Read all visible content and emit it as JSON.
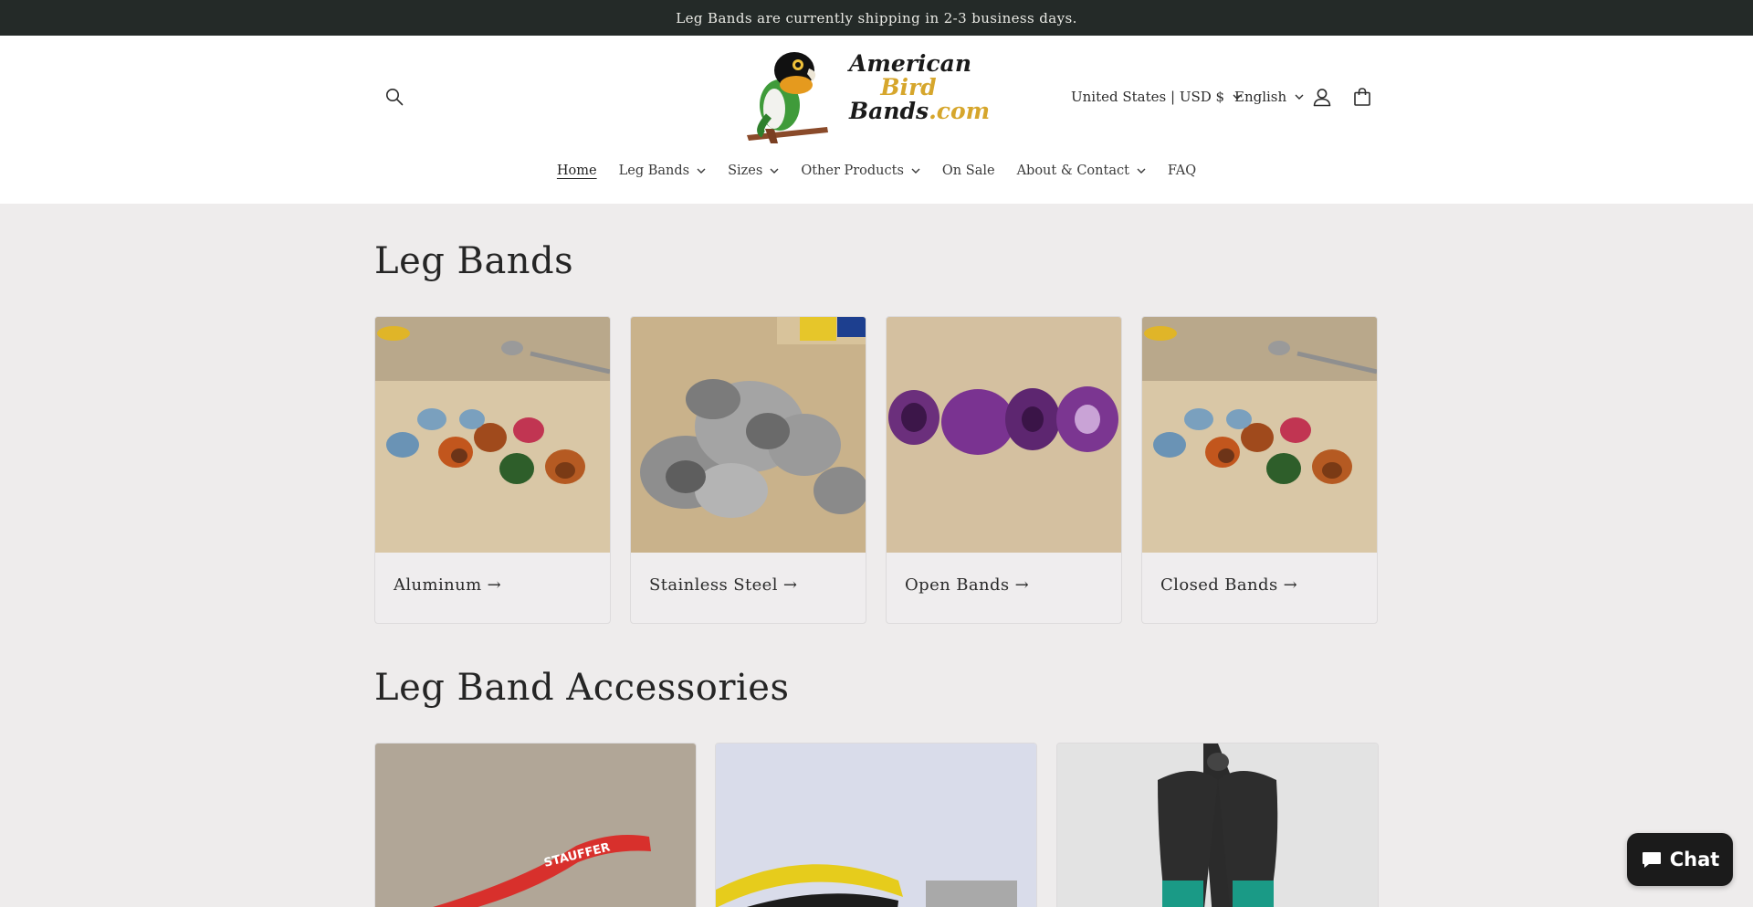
{
  "announcement": {
    "text": "Leg Bands are currently shipping in 2-3 business days."
  },
  "header": {
    "logo": {
      "line1": "American",
      "line2": "Bird",
      "line3": "Bands",
      "line3_suffix": ".com"
    },
    "country": "United States | USD $",
    "language": "English"
  },
  "nav": {
    "items": [
      {
        "label": "Home",
        "active": true,
        "dropdown": false
      },
      {
        "label": "Leg Bands",
        "dropdown": true
      },
      {
        "label": "Sizes",
        "dropdown": true
      },
      {
        "label": "Other Products",
        "dropdown": true
      },
      {
        "label": "On Sale",
        "dropdown": false
      },
      {
        "label": "About & Contact",
        "dropdown": true
      },
      {
        "label": "FAQ",
        "dropdown": false
      }
    ]
  },
  "leg_bands": {
    "title": "Leg Bands",
    "cards": [
      {
        "label": "Aluminum",
        "arrow": "→"
      },
      {
        "label": "Stainless Steel",
        "arrow": "→"
      },
      {
        "label": "Open Bands",
        "arrow": "→"
      },
      {
        "label": "Closed Bands",
        "arrow": "→"
      }
    ]
  },
  "accessories": {
    "title": "Leg Band Accessories",
    "images": [
      {
        "caption_text": "STAUFFER"
      },
      {
        "caption_text": ""
      },
      {
        "caption_text": ""
      }
    ]
  },
  "chat": {
    "label": "Chat"
  },
  "colors": {
    "announcement_bg": "#242a28",
    "page_bg": "#eeecec",
    "logo_gold": "#d6a62c"
  },
  "icons": [
    "search-icon",
    "account-icon",
    "cart-icon",
    "chevron-down-icon",
    "arrow-right-icon",
    "chat-icon"
  ]
}
